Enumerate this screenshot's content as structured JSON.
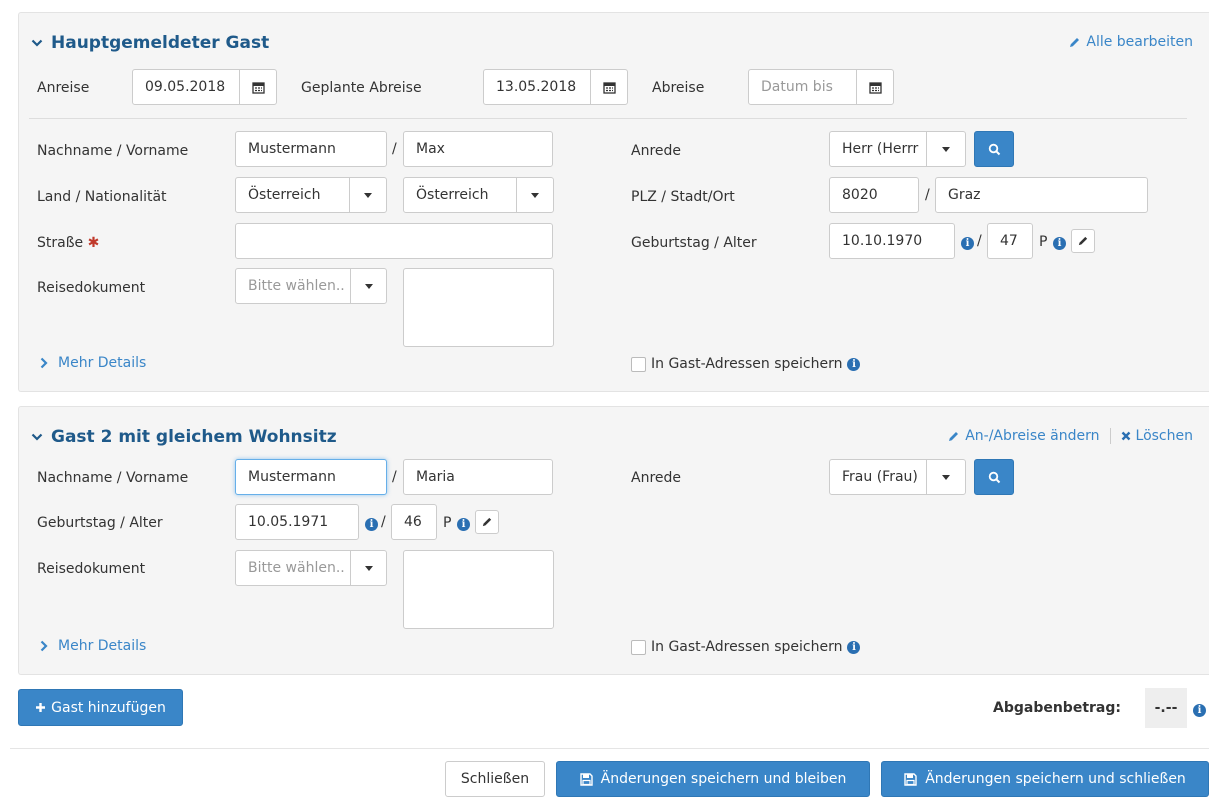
{
  "guest1": {
    "title": "Hauptgemeldeter Gast",
    "edit_all": "Alle bearbeiten",
    "arrival_label": "Anreise",
    "arrival_value": "09.05.2018",
    "planned_departure_label": "Geplante Abreise",
    "planned_departure_value": "13.05.2018",
    "departure_label": "Abreise",
    "departure_placeholder": "Datum bis",
    "name_label": "Nachname / Vorname",
    "lastname": "Mustermann",
    "firstname": "Max",
    "salutation_label": "Anrede",
    "salutation_value": "Herr (Herrr",
    "country_label": "Land / Nationalität",
    "country": "Österreich",
    "nationality": "Österreich",
    "zip_label": "PLZ / Stadt/Ort",
    "zip": "8020",
    "city": "Graz",
    "street_label": "Straße",
    "street_required": "✱",
    "street_value": "",
    "birthday_label": "Geburtstag / Alter",
    "birthday": "10.10.1970",
    "age": "47",
    "age_suffix": "P",
    "document_label": "Reisedokument",
    "document_placeholder": "Bitte wählen..",
    "more_details": "Mehr Details",
    "save_address": "In Gast-Adressen speichern",
    "slash": "/"
  },
  "guest2": {
    "title": "Gast 2 mit gleichem Wohnsitz",
    "change_dates": "An-/Abreise ändern",
    "delete": "Löschen",
    "name_label": "Nachname / Vorname",
    "lastname": "Mustermann",
    "firstname": "Maria",
    "salutation_label": "Anrede",
    "salutation_value": "Frau (Frau)",
    "birthday_label": "Geburtstag / Alter",
    "birthday": "10.05.1971",
    "age": "46",
    "age_suffix": "P",
    "document_label": "Reisedokument",
    "document_placeholder": "Bitte wählen..",
    "more_details": "Mehr Details",
    "save_address": "In Gast-Adressen speichern",
    "slash": "/"
  },
  "footer": {
    "add_guest": "Gast hinzufügen",
    "levy_label": "Abgabenbetrag:",
    "levy_value": "-.--",
    "close": "Schließen",
    "save_stay": "Änderungen speichern und bleiben",
    "save_close": "Änderungen speichern und schließen"
  },
  "colors": {
    "accent": "#3a86c8",
    "title": "#1f5a8a"
  }
}
